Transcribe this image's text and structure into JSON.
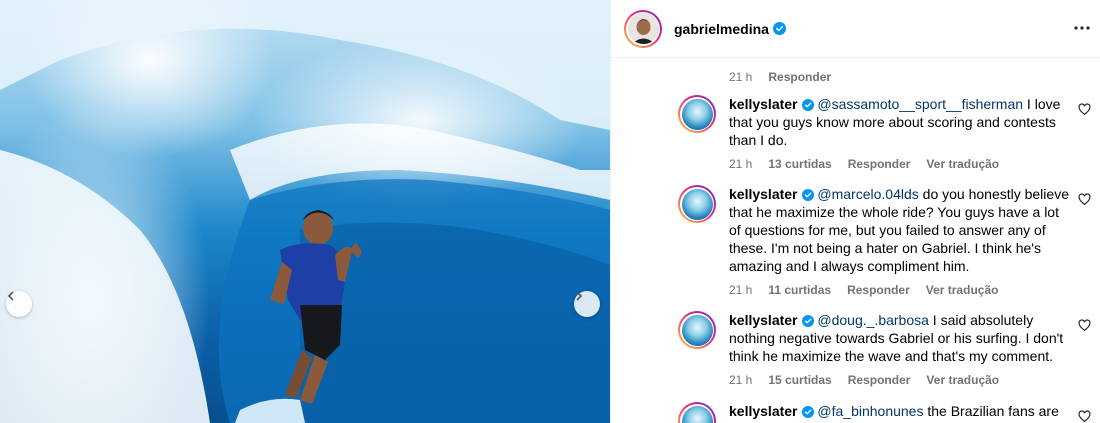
{
  "header": {
    "username": "gabrielmedina",
    "verified": true
  },
  "colors": {
    "verified_blue": "#0095f6",
    "mention_blue": "#00376b",
    "meta_gray": "#737373"
  },
  "prev_comment_meta": {
    "time": "21 h",
    "reply_label": "Responder"
  },
  "comments": [
    {
      "user": "kellyslater",
      "mention": "@sassamoto__sport__fisherman",
      "text": " I love that you guys know more about scoring and contests than I do.",
      "time": "21 h",
      "likes": "13 curtidas",
      "reply_label": "Responder",
      "translate_label": "Ver tradução"
    },
    {
      "user": "kellyslater",
      "mention": "@marcelo.04lds",
      "text": " do you honestly believe that he maximize the whole ride? You guys have a lot of questions for me, but you failed to answer any of these. I'm not being a hater on Gabriel. I think he's amazing and I always compliment him.",
      "time": "21 h",
      "likes": "11 curtidas",
      "reply_label": "Responder",
      "translate_label": "Ver tradução"
    },
    {
      "user": "kellyslater",
      "mention": "@doug._.barbosa",
      "text": " I said absolutely nothing negative towards Gabriel or his surfing. I don't think he maximize the wave and that's my comment.",
      "time": "21 h",
      "likes": "15 curtidas",
      "reply_label": "Responder",
      "translate_label": "Ver tradução"
    },
    {
      "user": "kellyslater",
      "mention": "@fa_binhonunes",
      "text": " the Brazilian fans are",
      "time": "",
      "likes": "",
      "reply_label": "",
      "translate_label": ""
    }
  ],
  "icons": {
    "verified": "verified-badge-icon",
    "more": "more-options-icon",
    "like": "heart-icon",
    "prev": "chevron-left-icon",
    "next": "chevron-right-icon"
  }
}
